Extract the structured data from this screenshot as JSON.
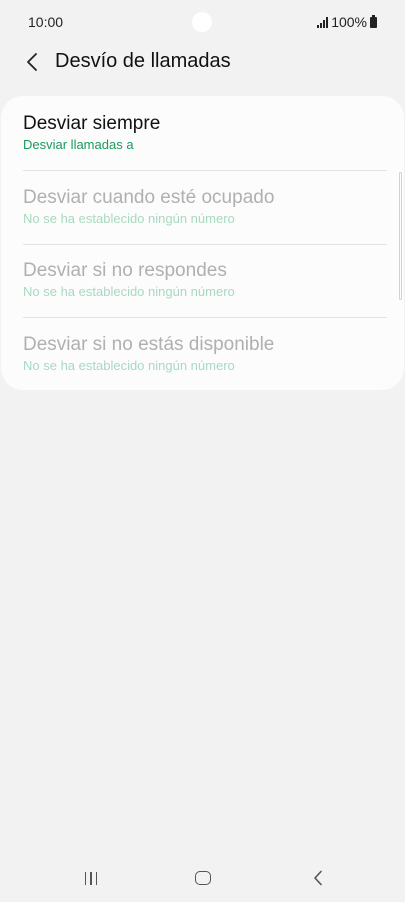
{
  "status_bar": {
    "time": "10:00",
    "battery": "100%"
  },
  "header": {
    "title": "Desvío de llamadas"
  },
  "options": [
    {
      "title": "Desviar siempre",
      "subtitle": "Desviar llamadas a",
      "enabled": true
    },
    {
      "title": "Desviar cuando esté ocupado",
      "subtitle": "No se ha establecido ningún número",
      "enabled": false
    },
    {
      "title": "Desviar si no respondes",
      "subtitle": "No se ha establecido ningún número",
      "enabled": false
    },
    {
      "title": "Desviar si no estás disponible",
      "subtitle": "No se ha establecido ningún número",
      "enabled": false
    }
  ],
  "icons": {
    "back": "chevron-left-icon",
    "signal": "signal-icon",
    "battery": "battery-icon",
    "nav_recents": "recents-icon",
    "nav_home": "home-icon",
    "nav_back": "back-icon"
  },
  "colors": {
    "background": "#f2f2f2",
    "card": "#fcfcfc",
    "accent_green": "#1a9a5e",
    "disabled_text": "#b0b0b0",
    "disabled_subtitle": "#a8d9c1"
  }
}
